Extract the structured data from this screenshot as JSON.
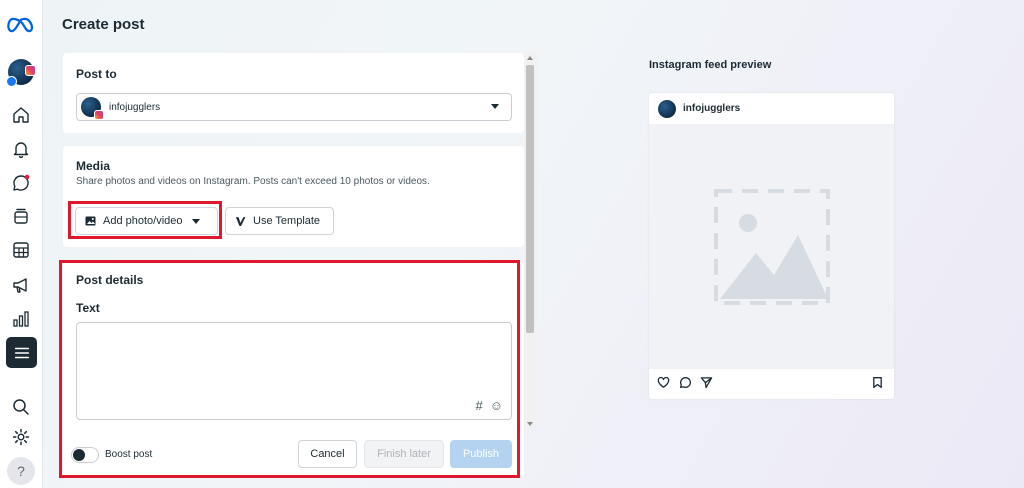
{
  "page": {
    "title": "Create post"
  },
  "post_to": {
    "heading": "Post to",
    "account": "infojugglers"
  },
  "media": {
    "heading": "Media",
    "description": "Share photos and videos on Instagram. Posts can't exceed 10 photos or videos.",
    "add_label": "Add photo/video",
    "template_label": "Use Template"
  },
  "details": {
    "heading": "Post details",
    "text_label": "Text",
    "hashtag_symbol": "#",
    "emoji_symbol": "☺",
    "boost_label": "Boost post",
    "cancel_label": "Cancel",
    "finish_label": "Finish later",
    "publish_label": "Publish"
  },
  "preview": {
    "title": "Instagram feed preview",
    "account": "infojugglers"
  },
  "rail": {
    "help_symbol": "?"
  },
  "colors": {
    "highlight": "#dc1a2b",
    "publish_bg": "#b3d3f0",
    "dark": "#1c2b33",
    "meta_blue": "#0064e0"
  },
  "icons": [
    "meta-logo-icon",
    "home-icon",
    "bell-icon",
    "chat-icon",
    "layers-icon",
    "calendar-icon",
    "megaphone-icon",
    "bar-chart-icon",
    "menu-icon",
    "search-icon",
    "gear-icon",
    "help-icon",
    "photo-icon",
    "template-icon",
    "heart-icon",
    "comment-icon",
    "send-icon",
    "bookmark-icon",
    "image-placeholder-icon"
  ]
}
